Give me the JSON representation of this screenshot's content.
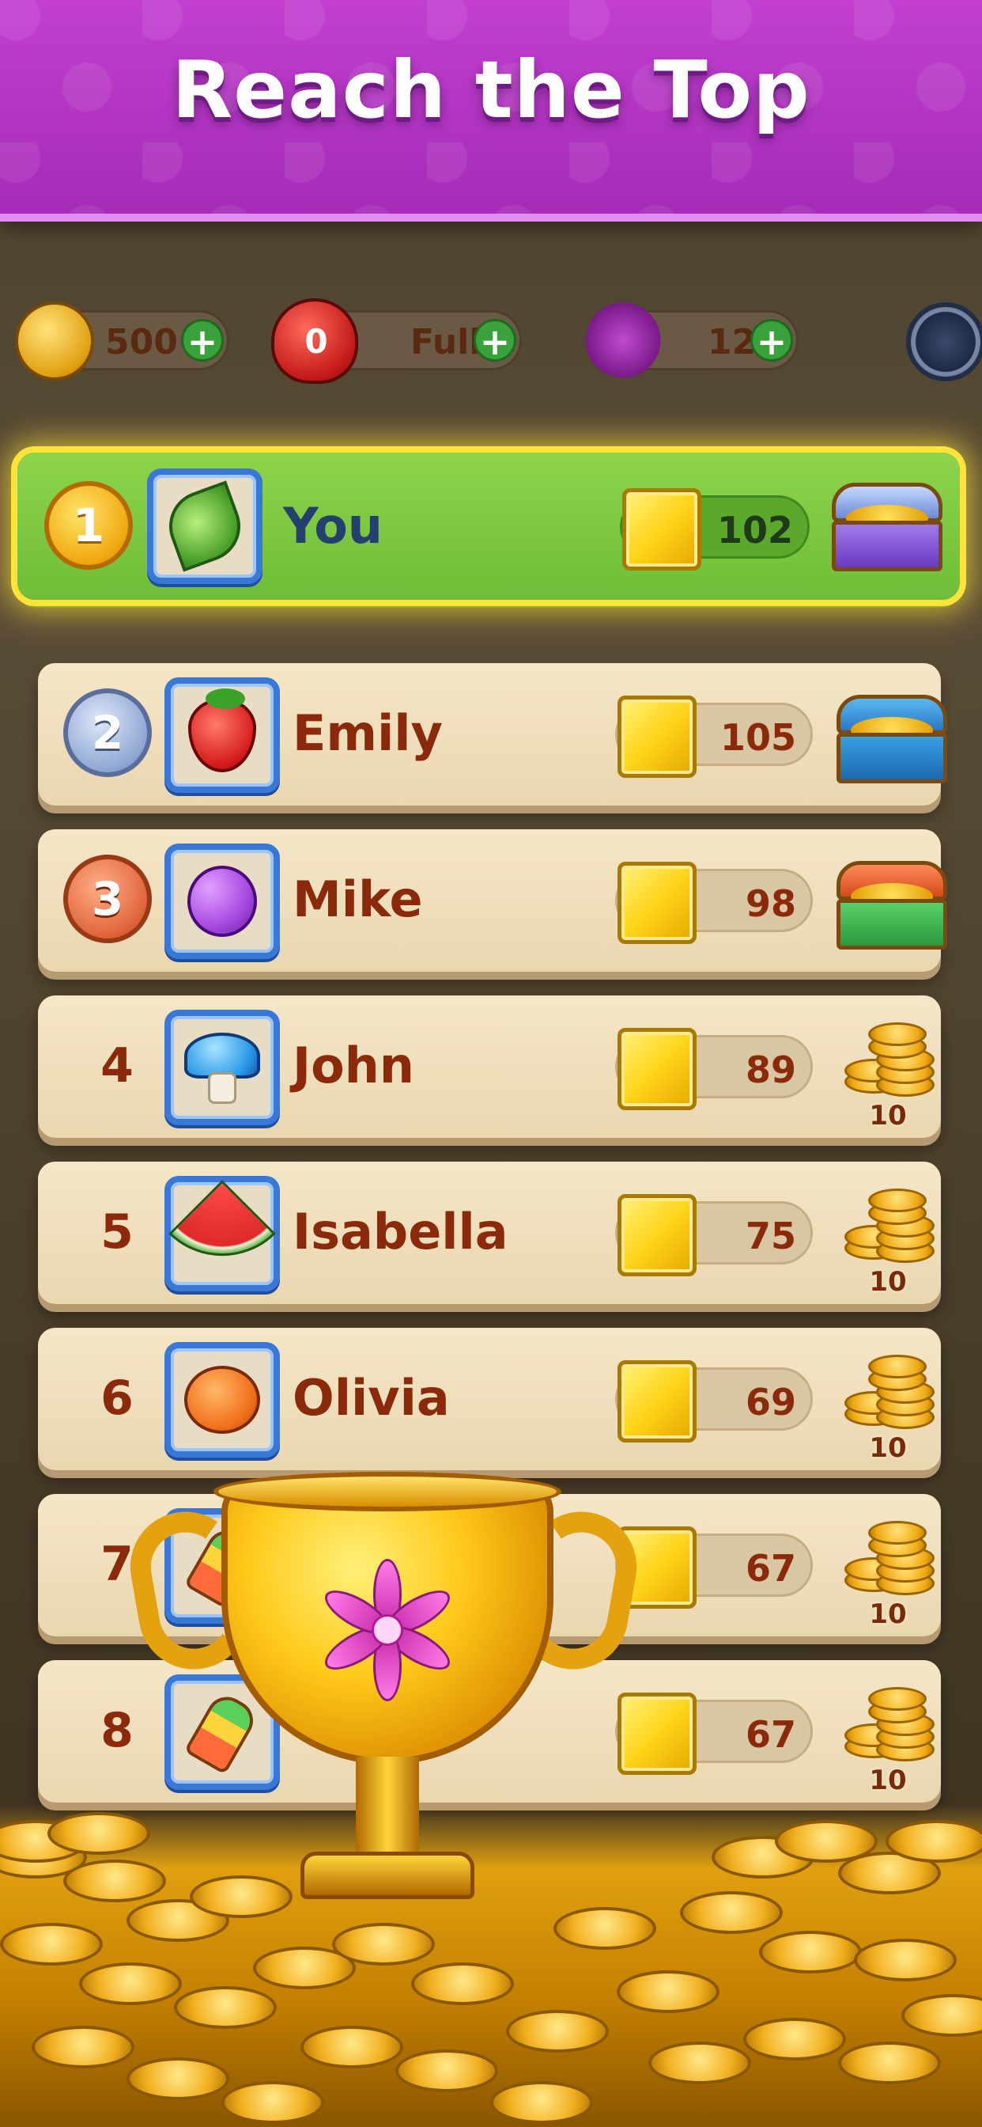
{
  "header": {
    "title": "Reach the Top"
  },
  "statusbar": {
    "coins": "500",
    "lives_count": "0",
    "lives_status": "Full",
    "stars": "12"
  },
  "rows": [
    {
      "rank": "1",
      "name": "You",
      "avatar": "leaf-icon",
      "score": "102",
      "reward": "chest-purple"
    },
    {
      "rank": "2",
      "name": "Emily",
      "avatar": "strawberry-icon",
      "score": "105",
      "reward": "chest-blue"
    },
    {
      "rank": "3",
      "name": "Mike",
      "avatar": "grape-icon",
      "score": "98",
      "reward": "chest-green"
    },
    {
      "rank": "4",
      "name": "John",
      "avatar": "mushroom-icon",
      "score": "89",
      "reward": "coins",
      "reward_amount": "10"
    },
    {
      "rank": "5",
      "name": "Isabella",
      "avatar": "watermelon-icon",
      "score": "75",
      "reward": "coins",
      "reward_amount": "10"
    },
    {
      "rank": "6",
      "name": "Olivia",
      "avatar": "pumpkin-icon",
      "score": "69",
      "reward": "coins",
      "reward_amount": "10"
    },
    {
      "rank": "7",
      "name": "",
      "avatar": "popsicle-icon",
      "score": "67",
      "reward": "coins",
      "reward_amount": "10"
    },
    {
      "rank": "8",
      "name": "",
      "avatar": "popsicle-icon",
      "score": "67",
      "reward": "coins",
      "reward_amount": "10"
    }
  ],
  "colors": {
    "header_purple": "#b535c4",
    "you_green": "#7cc940",
    "highlight_yellow": "#ffe33a",
    "row_cream": "#f0e0be",
    "name_brown": "#8a2a0a",
    "avatar_blue": "#3a78d8"
  }
}
